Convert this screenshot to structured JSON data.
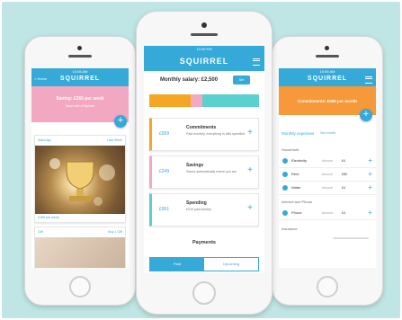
{
  "colors": {
    "background": "#bfe6e4",
    "brand": "#35a9d8",
    "commitments": "#f5a623",
    "savings": "#f4a9c0",
    "spending": "#5ccfcf",
    "left_banner": "#f2a8c0",
    "right_banner": "#f5993a"
  },
  "left_phone": {
    "status_time": "10:05 AM",
    "back_label": "< Home",
    "app_name": "SQUIRREL",
    "banner_line1": "Saving: £265 per week",
    "banner_line2": "Save with a Squirrel",
    "card_left": "Saturday",
    "card_right": "Last Week",
    "card_footer": "£180  per week",
    "card2_left": "Gift",
    "card2_right": "Buy 1 Gift"
  },
  "center_phone": {
    "status_time": "12:05 PM",
    "app_name": "SQUIRREL",
    "salary_label": "Monthly salary: £2,500",
    "set_button": "Set",
    "bar_split": {
      "commitments": 0.38,
      "savings": 0.1,
      "spending": 0.52
    },
    "cards": [
      {
        "amount": "£659",
        "title": "Commitments",
        "desc": "Paid monthly, everything in bills specified"
      },
      {
        "amount": "£249",
        "title": "Savings",
        "desc": "Saved automatically where you are"
      },
      {
        "amount": "£951",
        "title": "Spending",
        "desc": "£220 paid weekly"
      }
    ],
    "payments_title": "Payments",
    "tabs": [
      "Paid",
      "Upcoming"
    ]
  },
  "right_phone": {
    "status_time": "10:05 AM",
    "app_name": "SQUIRREL",
    "banner_text": "Commitments: £586 per month",
    "section_label": "Monthly expenses",
    "section_link": "See month",
    "subsection1": "Household",
    "rows": [
      {
        "name": "Electricity",
        "label": "Amount",
        "value": "£4"
      },
      {
        "name": "Rent",
        "label": "Amount",
        "value": "£80"
      },
      {
        "name": "Water",
        "label": "Amount",
        "value": "£4"
      }
    ],
    "subsection2": "Internet and Phone",
    "rows2": [
      {
        "name": "Phone",
        "label": "Amount",
        "value": "£4"
      }
    ],
    "subsection3": "Insurance"
  }
}
